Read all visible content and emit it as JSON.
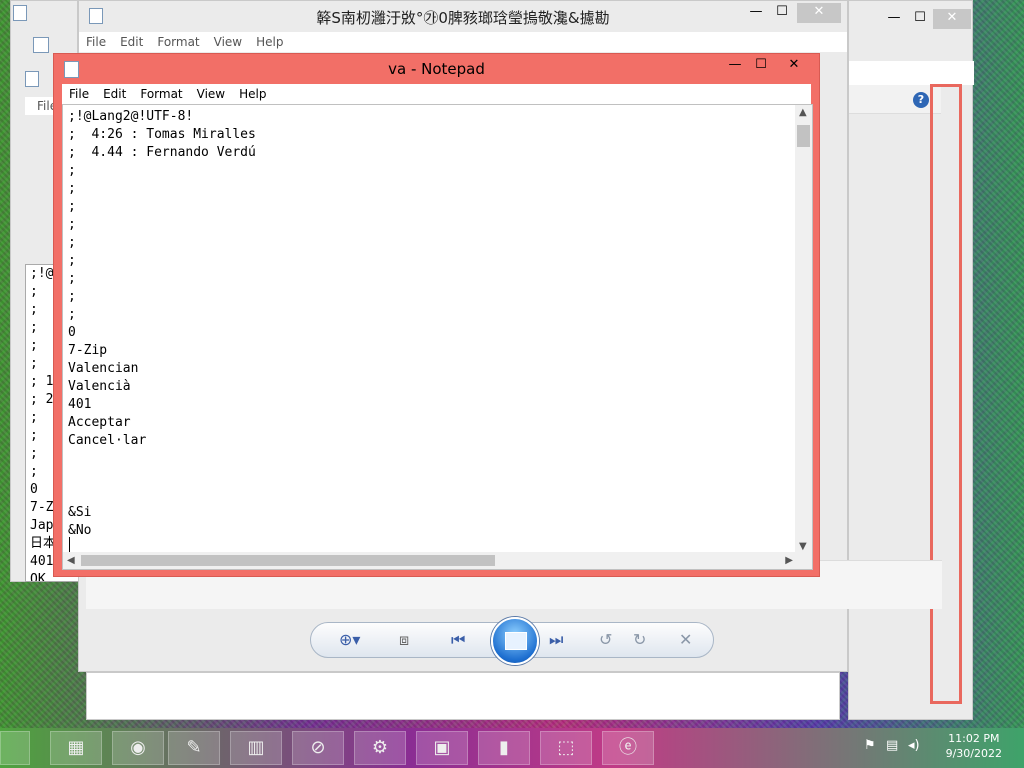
{
  "back_window": {
    "title": "簳S南杒灉汙敚°㉮0脾豥瑯琀瑩摀敬瀺&攄勘",
    "menu": [
      "File",
      "Edit",
      "Format",
      "View",
      "Help"
    ],
    "min": "—",
    "max": "☐",
    "close": "✕"
  },
  "left_window": {
    "menu_label": "File",
    "doc_text": ";!@\n;\n;\n;\n;\n;\n; 1\n; 2\n;\n;\n;\n;\n0\n7-Z\nJap\n日本\n401\nOK"
  },
  "right_window": {
    "min": "—",
    "max": "☐",
    "close": "✕",
    "help": "?"
  },
  "notepad": {
    "title": "va - Notepad",
    "menu": [
      "File",
      "Edit",
      "Format",
      "View",
      "Help"
    ],
    "min": "—",
    "max": "☐",
    "close": "✕",
    "content": ";!@Lang2@!UTF-8!\n;  4:26 : Tomas Miralles\n;  4.44 : Fernando Verdú\n;\n;\n;\n;\n;\n;\n;\n;\n;\n0\n7-Zip\nValencian\nValencià\n401\nAcceptar\nCancel·lar\n\n\n\n&Si\n&No"
  },
  "viewer_toolbar": {
    "zoom": "⊕▾",
    "fit": "⧈",
    "prev": "⏮",
    "next": "⏭",
    "rotate_left": "↺",
    "rotate_right": "↻",
    "delete": "✕"
  },
  "taskbar": {
    "apps": [
      "▦",
      "◉",
      "✎",
      "▥",
      "⊘",
      "⚙",
      "▣",
      "▮",
      "⬚",
      "ⓔ"
    ],
    "tray": [
      "⚑",
      "▤",
      "◂)"
    ],
    "time": "11:02 PM",
    "date": "9/30/2022"
  }
}
